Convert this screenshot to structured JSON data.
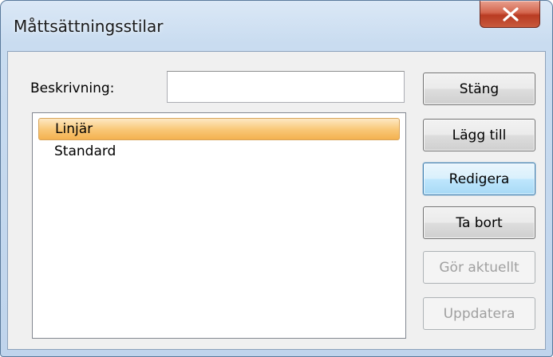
{
  "window": {
    "title": "Måttsättningsstilar",
    "close_icon": "close-icon"
  },
  "description": {
    "label": "Beskrivning:",
    "value": "",
    "placeholder": ""
  },
  "styles_list": {
    "items": [
      {
        "label": "Linjär",
        "selected": true
      },
      {
        "label": "Standard",
        "selected": false
      }
    ],
    "selection_color": "#f9c97a"
  },
  "buttons": {
    "close": "Stäng",
    "add": "Lägg till",
    "edit": "Redigera",
    "delete": "Ta bort",
    "set_current": "Gör aktuellt",
    "update": "Uppdatera"
  },
  "colors": {
    "close_button": "#c75a3d",
    "default_button": "#bee6fd",
    "window_frame": "#bfd4ec"
  }
}
